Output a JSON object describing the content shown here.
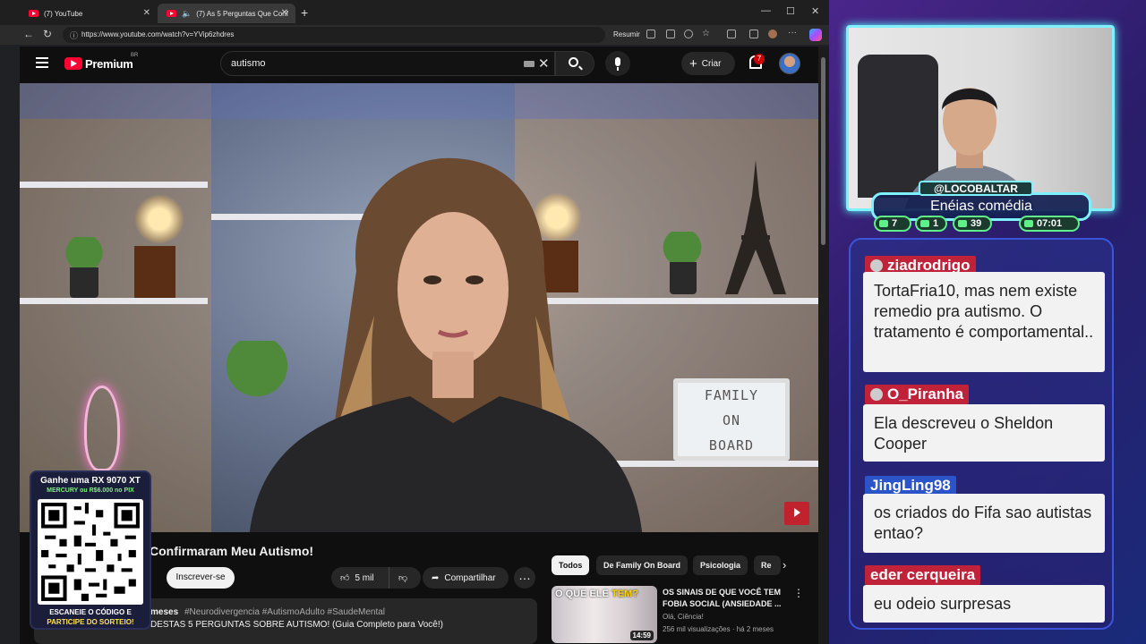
{
  "browser": {
    "tabs": [
      {
        "label": "(7) YouTube",
        "active": false
      },
      {
        "label": "(7) As 5 Perguntas Que Conf",
        "active": true
      }
    ],
    "url": "https://www.youtube.com/watch?v=YVip6zhdres",
    "resumir": "Resumir"
  },
  "youtube": {
    "logo": "Premium",
    "region": "BR",
    "search_query": "autismo",
    "create_label": "Criar",
    "notifications": "7",
    "video_title_visible": "Confirmaram Meu Autismo!",
    "subscribe_label": "Inscrever-se",
    "likes": "5 mil",
    "share_label": "Compartilhar",
    "description": {
      "age": "meses",
      "hashtags": "#Neurodivergencia #AutismoAdulto #SaudeMental",
      "line2": "DESTAS 5 PERGUNTAS SOBRE AUTISMO! (Guia Completo para Você!)"
    },
    "chips": [
      "Todos",
      "De Family On Board",
      "Psicologia",
      "Re"
    ],
    "recommended": {
      "thumb_text_a": "O QUE ELE",
      "thumb_text_b": "TEM?",
      "duration": "14:59",
      "title": "OS SINAIS DE QUE VOCÊ TEM FOBIA SOCIAL (ANSIEDADE ...",
      "channel": "Olá, Ciência!",
      "meta": "256 mil visualizações · há 2 meses"
    },
    "video_sign": "FAMILY ON BOARD"
  },
  "qr_overlay": {
    "headline": "Ganhe uma RX 9070 XT",
    "sub": "MERCURY ou R$6.000 no PIX",
    "footer1": "ESCANEIE O CÓDIGO E",
    "footer2": "PARTICIPE DO SORTEIO!"
  },
  "stream": {
    "handle": "@LOCOBALTAR",
    "topic": "Enéias comédia",
    "stats": [
      {
        "icon": "chat-icon",
        "value": "7"
      },
      {
        "icon": "youtube-icon",
        "value": "1"
      },
      {
        "icon": "viewers-icon",
        "value": "39"
      },
      {
        "icon": "clock-icon",
        "value": "07:01"
      }
    ]
  },
  "chat": [
    {
      "user": "ziadrodrigo",
      "color": "#c0223a",
      "text": "TortaFria10, mas nem existe remedio pra autismo. O tratamento é comportamental.."
    },
    {
      "user": "O_Piranha",
      "color": "#c0223a",
      "text": "Ela descreveu o Sheldon Cooper"
    },
    {
      "user": "JingLing98",
      "color": "#2a54c8",
      "text": "os criados do Fifa sao autistas entao?"
    },
    {
      "user": "eder cerqueira",
      "color": "#c0223a",
      "text": "eu odeio surpresas"
    }
  ],
  "colors": {
    "accent_cyan": "#7ef0ff",
    "youtube_red": "#ff0033",
    "stat_green": "#5ff08a"
  }
}
